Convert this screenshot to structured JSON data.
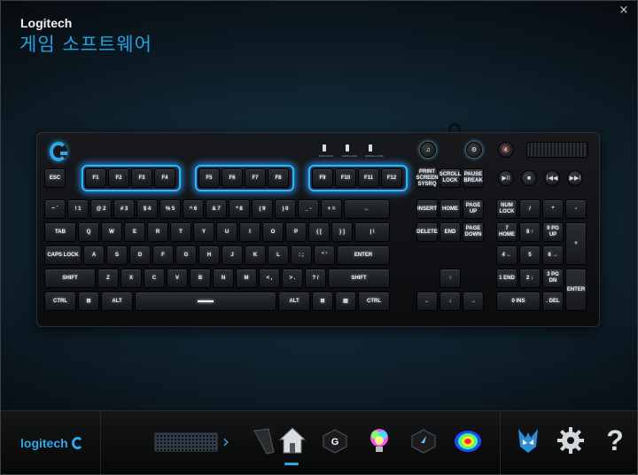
{
  "window": {
    "brand": "Logitech",
    "title": "게임 소프트웨어",
    "close_glyph": "×"
  },
  "keyboard": {
    "leds": [
      "NUM LOCK",
      "CAPS LOCK",
      "SCROLL LOCK"
    ],
    "media_top": [
      "♫",
      "⚙",
      "🔇"
    ],
    "media_row": [
      "▶II",
      "■",
      "I◀◀",
      "▶▶I"
    ],
    "row_fn": [
      "ESC",
      "F1",
      "F2",
      "F3",
      "F4",
      "F5",
      "F6",
      "F7",
      "F8",
      "F9",
      "F10",
      "F11",
      "F12",
      "PRINT SCREEN SYSRQ",
      "SCROLL LOCK",
      "PAUSE BREAK"
    ],
    "row_num": [
      "~ `",
      "! 1",
      "@ 2",
      "# 3",
      "$ 4",
      "% 5",
      "^ 6",
      "& 7",
      "* 8",
      "( 9",
      ") 0",
      "_ -",
      "+ =",
      "←",
      "INSERT",
      "HOME",
      "PAGE UP",
      "NUM LOCK",
      "/",
      "*",
      "-"
    ],
    "row_tab": [
      "TAB",
      "Q",
      "W",
      "E",
      "R",
      "T",
      "Y",
      "U",
      "I",
      "O",
      "P",
      "{ [",
      "} ]",
      "| \\",
      "DELETE",
      "END",
      "PAGE DOWN",
      "7 HOME",
      "8 ↑",
      "9 PG UP",
      "+"
    ],
    "row_caps": [
      "CAPS LOCK",
      "A",
      "S",
      "D",
      "F",
      "G",
      "H",
      "J",
      "K",
      "L",
      ": ;",
      "\" '",
      "ENTER",
      "4 ←",
      "5",
      "6 →"
    ],
    "row_shift": [
      "SHIFT",
      "Z",
      "X",
      "C",
      "V",
      "B",
      "N",
      "M",
      "< ,",
      "> .",
      "? /",
      "SHIFT",
      "↑",
      "1 END",
      "2 ↓",
      "3 PG DN",
      "ENTER"
    ],
    "row_ctrl": [
      "CTRL",
      "⊞",
      "ALT",
      "",
      "ALT",
      "⊞",
      "▤",
      "CTRL",
      "←",
      "↓",
      "→",
      "0 INS",
      ". DEL"
    ]
  },
  "dock": {
    "logo_text": "logitech",
    "chevron": "›",
    "icons": [
      "home-icon",
      "g-key-icon",
      "lighting-icon",
      "pointer-key-icon",
      "heatmap-icon",
      "arx-control-icon",
      "settings-icon",
      "help-icon"
    ],
    "help_glyph": "?"
  }
}
